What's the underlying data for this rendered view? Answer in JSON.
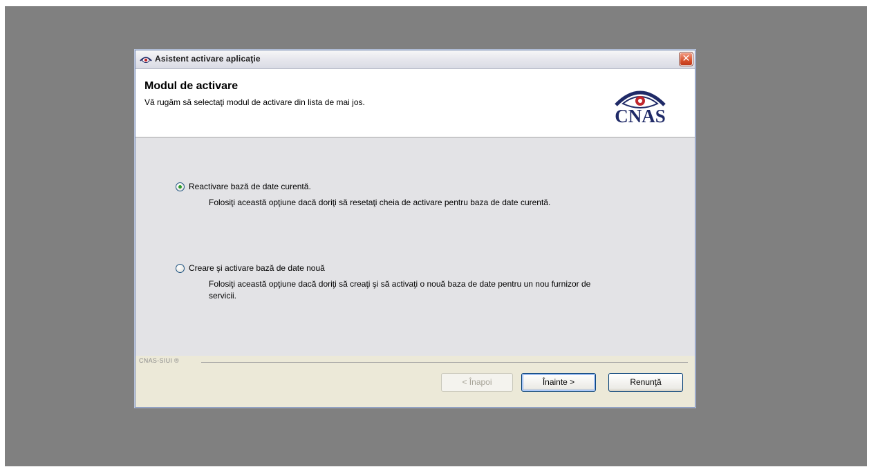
{
  "window": {
    "title": "Asistent activare aplicaţie",
    "close_symbol": "✕"
  },
  "header": {
    "title": "Modul de activare",
    "subtitle": "Vă rugăm să selectaţi modul de activare din lista de mai jos.",
    "logo_text": "CNAS"
  },
  "options": [
    {
      "label": "Reactivare bază de date curentă.",
      "description": "Folosiţi această opţiune dacă doriţi să resetaţi cheia de activare pentru baza de date curentă.",
      "selected": true
    },
    {
      "label": "Creare şi activare bază de date nouă",
      "description": "Folosiţi această opţiune dacă doriţi să creaţi şi să activaţi o nouă baza de date pentru un nou furnizor de servicii.",
      "selected": false
    }
  ],
  "footer": {
    "brand_mark": "CNAS-SIUI ®"
  },
  "buttons": {
    "back": "< Înapoi",
    "next": "Înainte >",
    "cancel": "Renunţă"
  },
  "colors": {
    "logo_blue": "#1f2a67",
    "logo_red": "#c0272d",
    "close_red": "#d9532f"
  }
}
